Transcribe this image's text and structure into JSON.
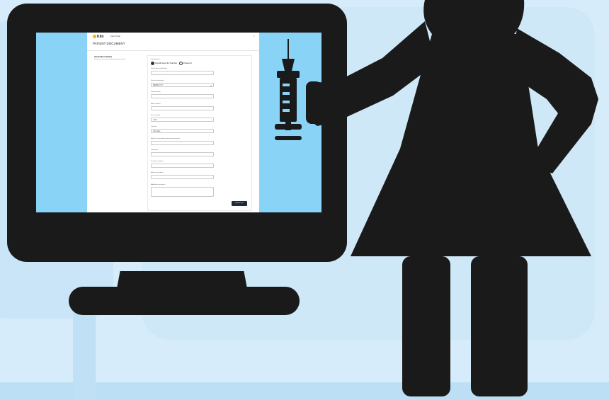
{
  "app": {
    "logo_text": "Kiln",
    "org_name": "Client Portal",
    "page_title": "PATIENT DOCUMENT",
    "close_symbol": "×"
  },
  "sidebar": {
    "title": "Vaccination details",
    "subtitle": "Fill in your vaccination information for records"
  },
  "form": {
    "id_type_label": "Identification",
    "radio_options": [
      "Social Security Number",
      "Passport"
    ],
    "fields": [
      {
        "label": "Social Security Number",
        "value": ""
      },
      {
        "label": "Date of vaccination",
        "value": "MM/DD/YYYY"
      },
      {
        "label": "Vaccine name",
        "value": ""
      },
      {
        "label": "Batch number",
        "value": ""
      },
      {
        "label": "Dose number",
        "value": "1 of 2"
      },
      {
        "label": "Location",
        "value": "City, State"
      },
      {
        "label": "Health care provider administering vaccine",
        "value": ""
      },
      {
        "label": "Telephone",
        "value": ""
      },
      {
        "label": "Provider's address",
        "value": ""
      },
      {
        "label": "Adverse reactions",
        "value": ""
      },
      {
        "label": "Additional comments",
        "value": ""
      }
    ],
    "calendar_icon": "calendar-icon",
    "submit_label": "Submit form"
  },
  "icons": [
    "syringe-icon",
    "person-silhouette-icon"
  ],
  "colors": {
    "background": "#d6ecfa",
    "screen": "#89d3f6",
    "silhouette": "#1a1a1a",
    "logo_accent": "#f6b800"
  }
}
